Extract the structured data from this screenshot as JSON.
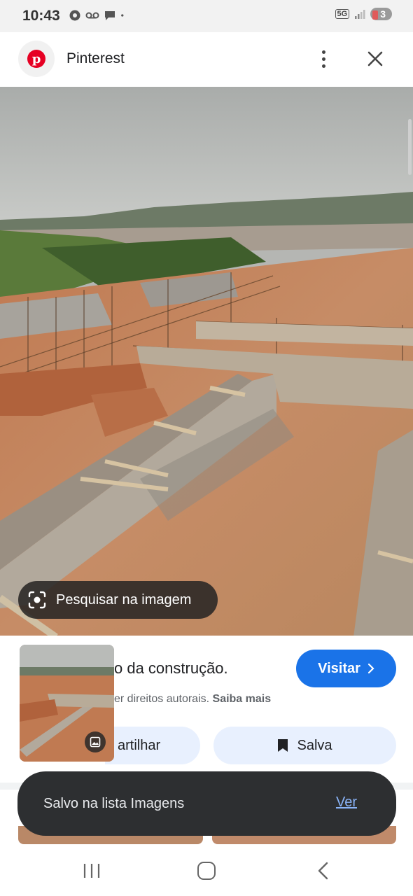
{
  "status_bar": {
    "time": "10:43",
    "network": "5G",
    "battery": "3",
    "icons": [
      "chrome-icon",
      "voicemail-icon",
      "chat-bubble-icon",
      "dot-icon",
      "signal-icon",
      "battery-icon"
    ]
  },
  "app_bar": {
    "title": "Pinterest",
    "logo_letter": "p",
    "brand_color": "#e60023"
  },
  "image": {
    "lens_label": "Pesquisar na imagem"
  },
  "result": {
    "title": "o da construção.",
    "rights_text": "er direitos autorais.",
    "rights_link": "Saiba mais",
    "visit_label": "Visitar",
    "share_label": "artilhar",
    "save_label": "Salva",
    "accent_color": "#1a73e8"
  },
  "snackbar": {
    "message": "Salvo na lista Imagens",
    "action": "Ver"
  }
}
